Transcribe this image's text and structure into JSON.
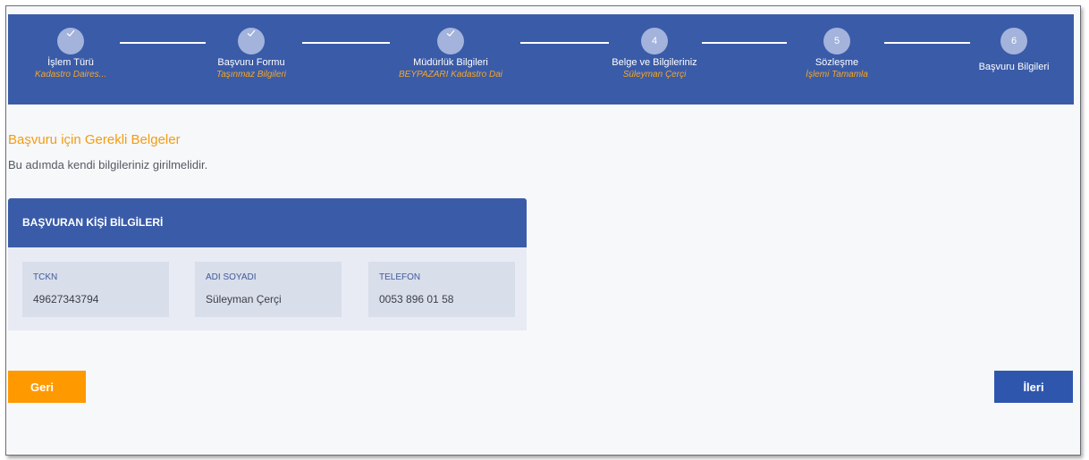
{
  "stepper": {
    "steps": [
      {
        "title": "İşlem Türü",
        "subtitle": "Kadastro Daires...",
        "status": "completed",
        "icon": "check-icon"
      },
      {
        "title": "Başvuru Formu",
        "subtitle": "Taşınmaz Bilgileri",
        "status": "completed",
        "icon": "check-icon"
      },
      {
        "title": "Müdürlük Bilgileri",
        "subtitle": "BEYPAZARI Kadastro Dai",
        "status": "completed",
        "icon": "check-icon"
      },
      {
        "title": "Belge ve Bilgileriniz",
        "subtitle": "Süleyman Çerçi",
        "number": "4",
        "status": "pending"
      },
      {
        "title": "Sözleşme",
        "subtitle": "İşlemi Tamamla",
        "number": "5",
        "status": "pending"
      },
      {
        "title": "Başvuru Bilgileri",
        "subtitle": "",
        "number": "6",
        "status": "pending"
      }
    ]
  },
  "section": {
    "title": "Başvuru için Gerekli Belgeler",
    "description": "Bu adımda kendi bilgileriniz girilmelidir."
  },
  "applicant_card": {
    "header": "BAŞVURAN KİŞİ BİLGİLERİ",
    "fields": [
      {
        "label": "TCKN",
        "value": "49627343794"
      },
      {
        "label": "ADI SOYADI",
        "value": "Süleyman Çerçi"
      },
      {
        "label": "TELEFON",
        "value": "0053 896 01 58"
      }
    ]
  },
  "buttons": {
    "back": "Geri",
    "next": "İleri"
  },
  "colors": {
    "primary": "#3a5ba8",
    "accent": "#f39c12",
    "back_button": "#ff9900",
    "next_button": "#2e56ad"
  }
}
